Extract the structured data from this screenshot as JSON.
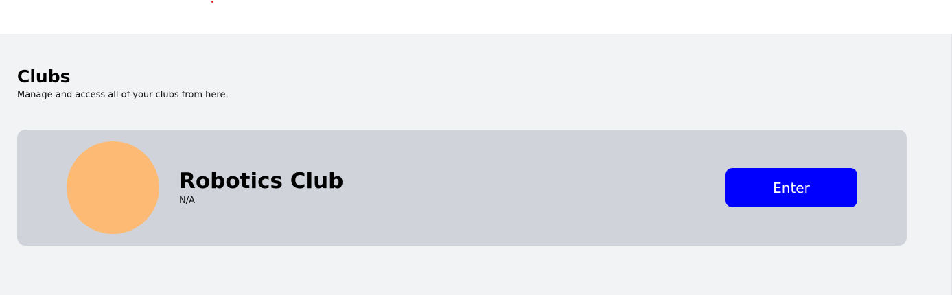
{
  "colors": {
    "accent": "#0000ff",
    "avatar": "#fdba74",
    "card_bg": "#d1d3db",
    "page_bg": "#f2f3f5"
  },
  "page": {
    "title": "Clubs",
    "subtitle": "Manage and access all of your clubs from here."
  },
  "clubs": [
    {
      "name": "Robotics Club",
      "description": "N/A",
      "button_label": "Enter"
    }
  ]
}
